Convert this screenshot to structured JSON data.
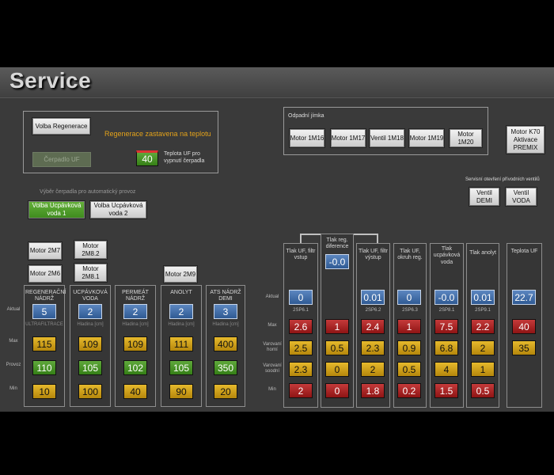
{
  "title": "Service",
  "regen": {
    "button": "Volba Regenerace",
    "status": "Regenerace zastavena na teplotu",
    "pump_button": "Čerpadlo UF",
    "temp_value": "40",
    "temp_label": "Teplota UF pro vypnutí čerpadla"
  },
  "pump_select": {
    "label": "Výběr čerpadla pro automatický provoz",
    "opt1": "Volba Ucpávková voda 1",
    "opt2": "Volba Ucpávková voda 2"
  },
  "drain": {
    "title": "Odpadní jímka",
    "items": [
      "Motor 1M16",
      "Motor 1M17",
      "Ventil 1M18",
      "Motor 1M19",
      "Motor 1M20"
    ]
  },
  "premix": "Motor K70 Aktivace PREMIX",
  "inlet": {
    "label": "Servisní otevření přívodních ventilů",
    "v1": "Ventil DEMI",
    "v2": "Ventil VODA"
  },
  "motors": {
    "m2m7": "Motor 2M7",
    "m2m6": "Motor 2M6",
    "m2m82": "Motor 2M8.2",
    "m2m81": "Motor 2M8.1",
    "m2m9": "Motor 2M9"
  },
  "row_labels": {
    "actual": "Aktual",
    "max": "Max",
    "provoz": "Provoz",
    "min": "Min",
    "warn_hi": "Varovaní horní",
    "warn_lo": "Varovaní soodní"
  },
  "tanks": [
    {
      "name": "REGENERAČNÍ NÁDRŽ",
      "actual": "5",
      "sub": "ULTRAFILTRACE",
      "max": "115",
      "provoz": "110",
      "min": "10"
    },
    {
      "name": "UCPÁVKOVÁ VODA",
      "actual": "2",
      "sub": "Hladina [cm]",
      "max": "109",
      "provoz": "105",
      "min": "100"
    },
    {
      "name": "PERMEÁT NÁDRŽ",
      "actual": "2",
      "sub": "Hladina [cm]",
      "max": "109",
      "provoz": "102",
      "min": "40"
    },
    {
      "name": "ANOLYT",
      "actual": "2",
      "sub": "Hladina [cm]",
      "max": "111",
      "provoz": "105",
      "min": "90"
    },
    {
      "name": "ATS NÁDRŽ DEMI",
      "actual": "3",
      "sub": "Hladina [cm]",
      "max": "400",
      "provoz": "350",
      "min": "20"
    }
  ],
  "pressure": [
    {
      "name": "Tlak UF, filtr vstup",
      "actual": "0",
      "sub": "2SP6.1",
      "max": "2.6",
      "warn_hi": "2.5",
      "warn_lo": "2.3",
      "min": "2"
    },
    {
      "name": "Tlak reg. diference",
      "actual": "-0.0",
      "sub": "",
      "max": "1",
      "warn_hi": "0.5",
      "warn_lo": "0",
      "min": "0"
    },
    {
      "name": "Tlak UF, filtr výstup",
      "actual": "0.01",
      "sub": "2SP6.2",
      "max": "2.4",
      "warn_hi": "2.3",
      "warn_lo": "2",
      "min": "1.8"
    },
    {
      "name": "Tlak UF, okruh reg.",
      "actual": "0",
      "sub": "2SP6.3",
      "max": "1",
      "warn_hi": "0.9",
      "warn_lo": "0.5",
      "min": "0.2"
    },
    {
      "name": "Tlak ucpávková voda",
      "actual": "-0.0",
      "sub": "2SP8.1",
      "max": "7.5",
      "warn_hi": "6.8",
      "warn_lo": "4",
      "min": "1.5"
    },
    {
      "name": "Tlak anolyt",
      "actual": "0.01",
      "sub": "2SP9.1",
      "max": "2.2",
      "warn_hi": "2",
      "warn_lo": "1",
      "min": "0.5"
    }
  ],
  "temp_uf": {
    "name": "Teplota UF",
    "actual": "22.7",
    "max": "40",
    "warn": "35"
  }
}
